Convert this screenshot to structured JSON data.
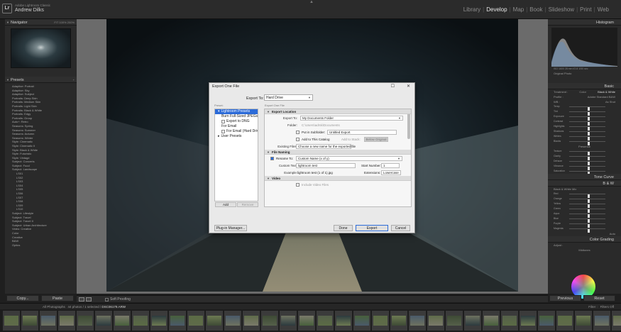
{
  "identity": {
    "app_label": "Lr",
    "sub": "Adobe Lightroom Classic",
    "name": "Andrew Dilks"
  },
  "modules": {
    "library": "Library",
    "develop": "Develop",
    "map": "Map",
    "book": "Book",
    "slideshow": "Slideshow",
    "print": "Print",
    "web": "Web"
  },
  "left_panel": {
    "navigator": "Navigator",
    "zoom": "FIT  100%  200%",
    "presets": "Presets",
    "presets_list": [
      "Adaptive: Portrait",
      "Adaptive: Sky",
      "Adaptive: Subject",
      "Portraits: Deep Skin",
      "Portraits: Medium Skin",
      "Portraits: Light Skin",
      "Portraits: Black & White",
      "Portraits: Edgy",
      "Portraits: Group",
      "Auto+: Retro",
      "Seasons: Spring",
      "Seasons: Summer",
      "Seasons: Autumn",
      "Seasons: Winter",
      "Style: Cinematic",
      "Style: Cinematic II",
      "Style: Black & White",
      "Style: Futuristic",
      "Style: Vintage",
      "Subject: Concerts",
      "Subject: Food",
      "Subject: Landscape"
    ],
    "presets_sub": [
      "LS01",
      "LS02",
      "LS03",
      "LS04",
      "LS05",
      "LS06",
      "LS07",
      "LS08",
      "LS09",
      "LS10"
    ],
    "presets_list2": [
      "Subject: Lifestyle",
      "Subject: Travel",
      "Subject: Travel II",
      "Subject: Urban Architecture",
      "Video: Creative"
    ],
    "presets_list3": [
      "Color",
      "Creative",
      "B&W",
      "Optics"
    ],
    "copy": "Copy...",
    "paste": "Paste"
  },
  "toolbar": {
    "soft_proofing": "Soft Proofing"
  },
  "right_panel": {
    "histogram": "Histogram",
    "histo_info": "ISO 1600   28 mm   f/2.8   1/50 sec",
    "original_photo": "Original Photo",
    "basic": "Basic",
    "treatment": "Treatment :",
    "color": "Color",
    "bw": "Black & White",
    "profile": "Profile :",
    "profile_value": "Adobe Standard B&W",
    "wb": "WB :",
    "wb_value": "As Shot",
    "sliders_tone": [
      "Temp",
      "Tint",
      "Exposure",
      "Contrast",
      "Highlights",
      "Shadows",
      "Whites",
      "Blacks"
    ],
    "tone": "Tone",
    "auto": "Auto",
    "exposure_val": "+ 0.00",
    "presence": "Presence",
    "sliders_presence": [
      "Texture",
      "Clarity",
      "Dehaze",
      "Vibrance",
      "Saturation"
    ],
    "tone_curve": "Tone Curve",
    "bw_mix": "B & W",
    "bw_mix_label": "Black & White Mix",
    "sliders_bw": [
      "Red",
      "Orange",
      "Yellow",
      "Green",
      "Aqua",
      "Blue",
      "Purple",
      "Magenta"
    ],
    "bw_auto": "Auto",
    "color_grading": "Color Grading",
    "adjust": "Adjust :",
    "midtones": "Midtones",
    "previous": "Previous",
    "reset": "Reset"
  },
  "filmstrip": {
    "source": "All Photographs",
    "count": "44 photos / 1 selected /",
    "file": "DSC06179.ARW",
    "filter": "Filter :",
    "filter_value": "Filters Off"
  },
  "dialog": {
    "title": "Export One File",
    "export_to_label": "Export To:",
    "export_to_value": "Hard Drive",
    "preset_label": "Preset:",
    "presets": [
      {
        "label": "Lightroom Presets",
        "selected": true,
        "sub": false,
        "check": false
      },
      {
        "label": "Burn Full-Sized JPEGs",
        "selected": false,
        "sub": true,
        "check": false
      },
      {
        "label": "Export to DNG",
        "selected": false,
        "sub": true,
        "check": true
      },
      {
        "label": "For Email",
        "selected": false,
        "sub": true,
        "check": false
      },
      {
        "label": "For Email (Hard Drive)",
        "selected": false,
        "sub": true,
        "check": true
      },
      {
        "label": "User Presets",
        "selected": false,
        "sub": false,
        "check": false
      }
    ],
    "add": "Add",
    "remove": "Remove",
    "right_label": "Export One File",
    "sec_location": "Export Location",
    "export_to2": "Export To:",
    "export_to2_value": "My Documents Folder",
    "folder_label": "Folder:",
    "folder_value": "C:\\Users\\adrsk\\Documents",
    "put_subfolder": "Put in Subfolder:",
    "subfolder_value": "Untitled Export",
    "add_catalog": "Add to This Catalog",
    "add_stack": "Add to Stack:",
    "below_original": "Below Original",
    "existing_label": "Existing Files:",
    "existing_value": "Choose a new name for the exported file",
    "sec_naming": "File Naming",
    "rename_label": "Rename To:",
    "rename_value": "Custom Name (x of y)",
    "custom_text_label": "Custom Text:",
    "custom_text_value": "lightroom test",
    "start_number_label": "Start Number:",
    "start_number_value": "1",
    "example_label": "Example:",
    "example_value": "lightroom test (1 of 1).jpg",
    "extensions_label": "Extensions:",
    "extensions_value": "Lowercase",
    "sec_video": "Video",
    "include_video": "Include Video Files",
    "plugin": "Plug-in Manager...",
    "done": "Done",
    "export": "Export",
    "cancel": "Cancel"
  },
  "colors": {
    "accent": "#2c6bd8",
    "panel": "#2a2a2a",
    "canvas": "#6b6b6b"
  }
}
